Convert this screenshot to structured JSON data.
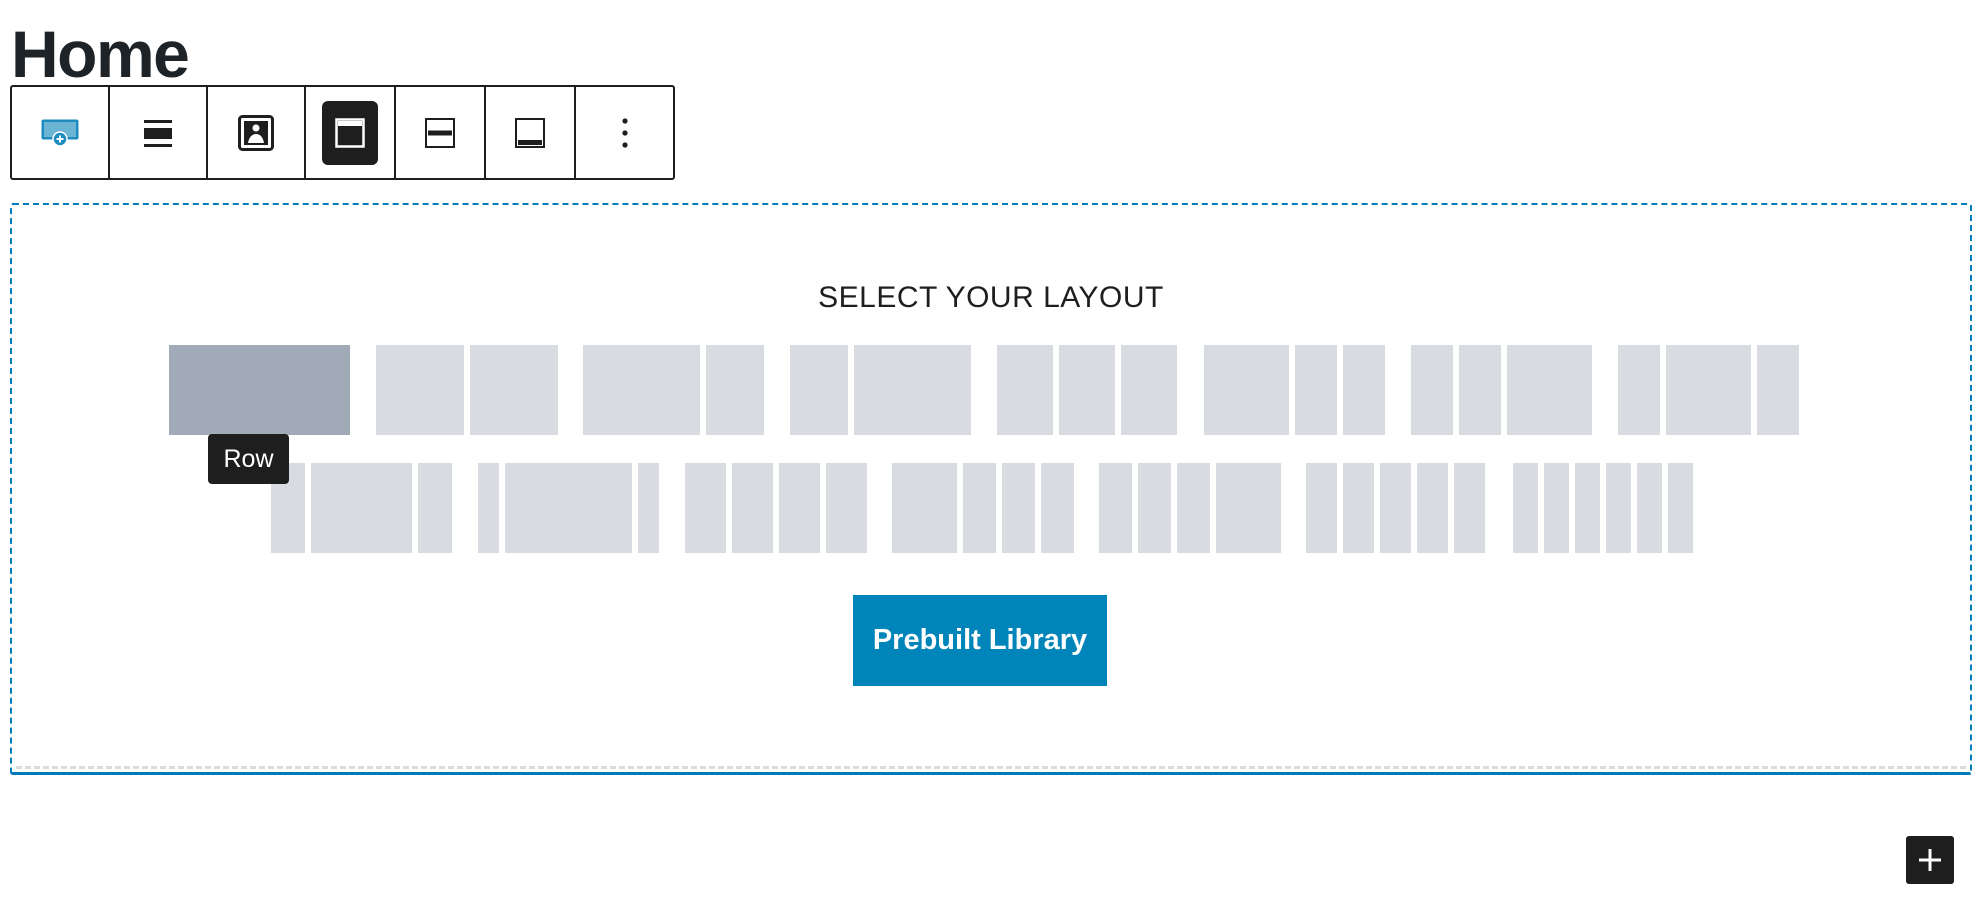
{
  "page": {
    "title": "Home"
  },
  "toolbar": {
    "items": [
      {
        "icon": "section-add-icon",
        "accent": "#1e8cbe"
      },
      {
        "icon": "align-full-icon"
      },
      {
        "icon": "background-image-icon"
      },
      {
        "icon": "vertical-align-top-icon",
        "active": true
      },
      {
        "icon": "vertical-align-middle-icon"
      },
      {
        "icon": "vertical-align-bottom-icon"
      },
      {
        "icon": "more-options-icon"
      }
    ]
  },
  "layout_picker": {
    "heading": "SELECT YOUR LAYOUT",
    "tooltip": "Row",
    "hovered_index": 0,
    "colors": {
      "column": "#d8dce0",
      "column_hover": "#a0abb7",
      "frame": "#007cba"
    },
    "row_1": [
      {
        "name": "one-column",
        "columns": [
          1
        ]
      },
      {
        "name": "two-equal",
        "columns": [
          1,
          1
        ]
      },
      {
        "name": "two-left-heavy",
        "columns": [
          2,
          1
        ]
      },
      {
        "name": "two-right-heavy",
        "columns": [
          1,
          2
        ]
      },
      {
        "name": "three-equal",
        "columns": [
          1,
          1,
          1
        ]
      },
      {
        "name": "three-left-heavy",
        "columns": [
          2,
          1,
          1
        ]
      },
      {
        "name": "three-right-heavy",
        "columns": [
          1,
          1,
          2
        ]
      },
      {
        "name": "three-center-heavy",
        "columns": [
          1,
          2,
          1
        ]
      }
    ],
    "row_2": [
      {
        "name": "three-center-wide",
        "columns": [
          1,
          3,
          1
        ]
      },
      {
        "name": "three-center-widest",
        "columns": [
          1,
          6,
          1
        ]
      },
      {
        "name": "four-equal",
        "columns": [
          1,
          1,
          1,
          1
        ]
      },
      {
        "name": "four-left-heavy",
        "columns": [
          2,
          1,
          1,
          1
        ]
      },
      {
        "name": "four-right-heavy",
        "columns": [
          1,
          1,
          1,
          2
        ]
      },
      {
        "name": "five-equal",
        "columns": [
          1,
          1,
          1,
          1,
          1
        ]
      },
      {
        "name": "six-equal",
        "columns": [
          1,
          1,
          1,
          1,
          1,
          1
        ]
      }
    ]
  },
  "prebuilt_button": {
    "label": "Prebuilt Library",
    "color": "#0085ba"
  },
  "add_block": {
    "icon": "plus-icon"
  }
}
